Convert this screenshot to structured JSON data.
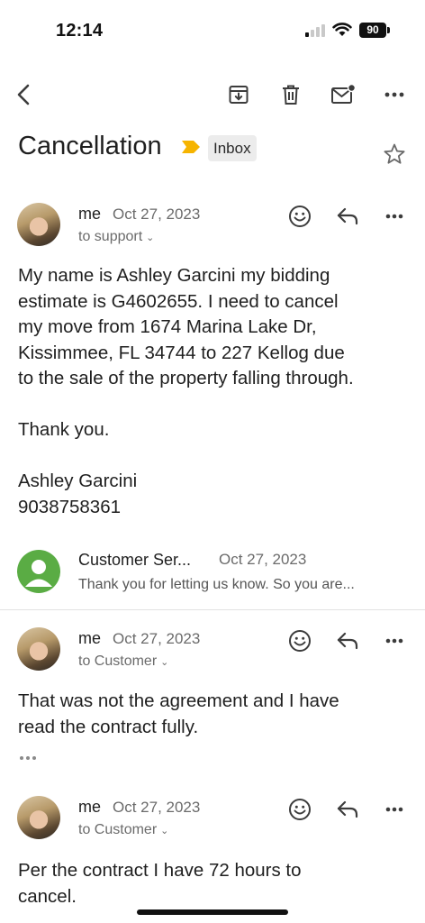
{
  "status_bar": {
    "time": "12:14",
    "battery": "90"
  },
  "toolbar": {
    "icons": [
      "back-arrow-icon",
      "archive-icon",
      "trash-icon",
      "mark-unread-icon",
      "more-icon"
    ]
  },
  "thread": {
    "subject": "Cancellation",
    "label": "Inbox",
    "important_color": "#f6b400"
  },
  "messages": [
    {
      "sender": "me",
      "date": "Oct 27, 2023",
      "to": "to support",
      "body": "My name is Ashley Garcini my bidding\nestimate is G4602655. I need to cancel\nmy move from 1674 Marina Lake Dr,\nKissimmee, FL 34744 to 227 Kellog due\nto the sale of the property falling through.\n\nThank you.\n\nAshley Garcini\n9038758361"
    },
    {
      "sender": "Customer Ser...",
      "date": "Oct 27, 2023",
      "snippet": "Thank you for letting us know. So you are...",
      "avatar_color": "#5aac44"
    },
    {
      "sender": "me",
      "date": "Oct 27, 2023",
      "to": "to Customer",
      "body": "That was not the agreement and I have\nread the contract fully."
    },
    {
      "sender": "me",
      "date": "Oct 27, 2023",
      "to": "to Customer",
      "body": "Per the contract I have 72 hours to\ncancel."
    }
  ]
}
